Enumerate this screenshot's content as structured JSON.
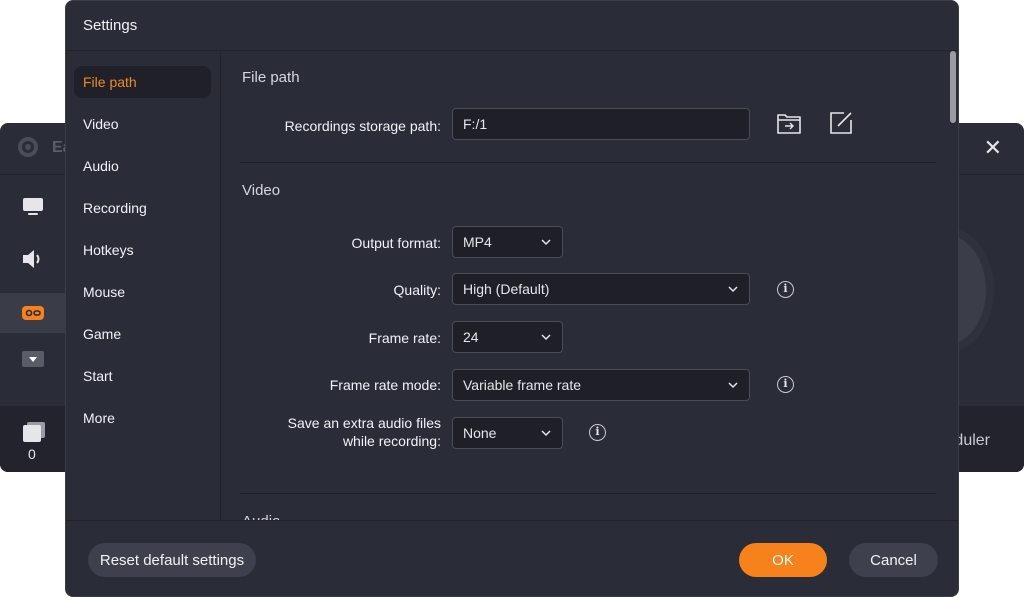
{
  "background_app": {
    "title_partial": "Ea",
    "count": "0",
    "scheduler_partial": "duler",
    "close_icon": "close-icon",
    "sidebar_icons": [
      "monitor-icon",
      "speaker-icon",
      "gamepad-icon",
      "dropdown-icon"
    ]
  },
  "dialog": {
    "title": "Settings",
    "nav": [
      {
        "label": "File path",
        "active": true
      },
      {
        "label": "Video"
      },
      {
        "label": "Audio"
      },
      {
        "label": "Recording"
      },
      {
        "label": "Hotkeys"
      },
      {
        "label": "Mouse"
      },
      {
        "label": "Game"
      },
      {
        "label": "Start"
      },
      {
        "label": "More"
      }
    ],
    "file_path": {
      "section_title": "File path",
      "storage_label": "Recordings storage path:",
      "storage_value": "F:/1",
      "open_folder_icon": "folder-open-icon",
      "edit_icon": "edit-icon"
    },
    "video": {
      "section_title": "Video",
      "output_format_label": "Output format:",
      "output_format_value": "MP4",
      "quality_label": "Quality:",
      "quality_value": "High (Default)",
      "frame_rate_label": "Frame rate:",
      "frame_rate_value": "24",
      "frame_rate_mode_label": "Frame rate mode:",
      "frame_rate_mode_value": "Variable frame rate",
      "extra_audio_label_line1": "Save an extra audio files",
      "extra_audio_label_line2": "while recording:",
      "extra_audio_value": "None",
      "info_glyph": "i"
    },
    "audio": {
      "section_title": "Audio"
    },
    "footer": {
      "reset_label": "Reset default settings",
      "ok_label": "OK",
      "cancel_label": "Cancel"
    }
  },
  "colors": {
    "accent": "#f7821b",
    "active_nav_text": "#f08a24",
    "dialog_bg": "#2a2c37",
    "field_bg": "#1e1f27"
  }
}
